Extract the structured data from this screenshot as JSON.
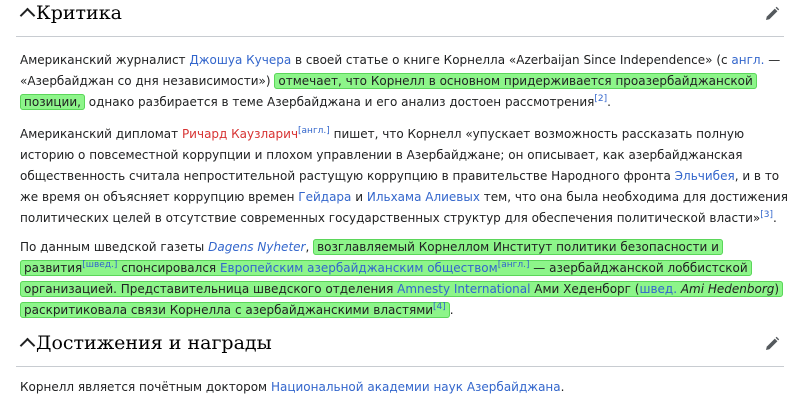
{
  "criticism": {
    "title": "Критика",
    "p1": {
      "t1": "Американский журналист ",
      "l1": "Джошуа Кучера",
      "t2": " в своей статье о книге Корнелла «Azerbaijan Since Independence» (с ",
      "l2": "англ.",
      "t3": " — «Азербайджан со дня независимости») ",
      "hl": "отмечает, что Корнелл в основном придерживается проазербайджанской позиции,",
      "t4": " однако разбирается в теме Азербайджана и его анализ достоен рассмотрения",
      "ref": "[2]",
      "t5": "."
    },
    "p2": {
      "t1": "Американский дипломат ",
      "l1": "Ричард Каузларич",
      "sup1": "[англ.]",
      "t2": " пишет, что Корнелл «упускает возможность рассказать полную историю о повсеместной коррупции и плохом управлении в Азербайджане; он описывает, как азербайджанская общественность считала непростительной растущую коррупцию в правительстве Народного фронта ",
      "l2": "Эльчибея",
      "t3": ", и в то же время он объясняет коррупцию времен ",
      "l3": "Гейдара",
      "t4": " и ",
      "l4": "Ильхама Алиевых",
      "t5": " тем, что она была необходима для достижения политических целей в отсутствие современных государственных структур для обеспечения политической власти»",
      "ref": "[3]",
      "t6": "."
    },
    "p3": {
      "t1": "По данным шведской газеты ",
      "l1": "Dagens Nyheter",
      "t2": ", ",
      "h1": "возглавляемый Корнеллом Институт политики безопасности и развития",
      "sup1": "[швед.]",
      "h2": " спонсировался ",
      "l2": "Европейским азербайджанским обществом",
      "sup2": "[англ.]",
      "h3": " — азербайджанской лоббистской организацией. Представительница шведского отделения ",
      "l3": "Amnesty International",
      "h4": " Ами Хеденборг (",
      "l4": "швед.",
      "h5": " ",
      "i1": "Ami Hedenborg",
      "h6": ") раскритиковала связи Корнелла с азербайджанскими властями",
      "ref": "[4]",
      "t3": "."
    }
  },
  "awards": {
    "title": "Достижения и награды",
    "p": {
      "t1": "Корнелл является почётным доктором ",
      "l1": "Национальной академии наук Азербайджана",
      "t2": "."
    }
  },
  "icons": {
    "collapse": "chevron-up-icon",
    "edit": "pencil-icon"
  }
}
